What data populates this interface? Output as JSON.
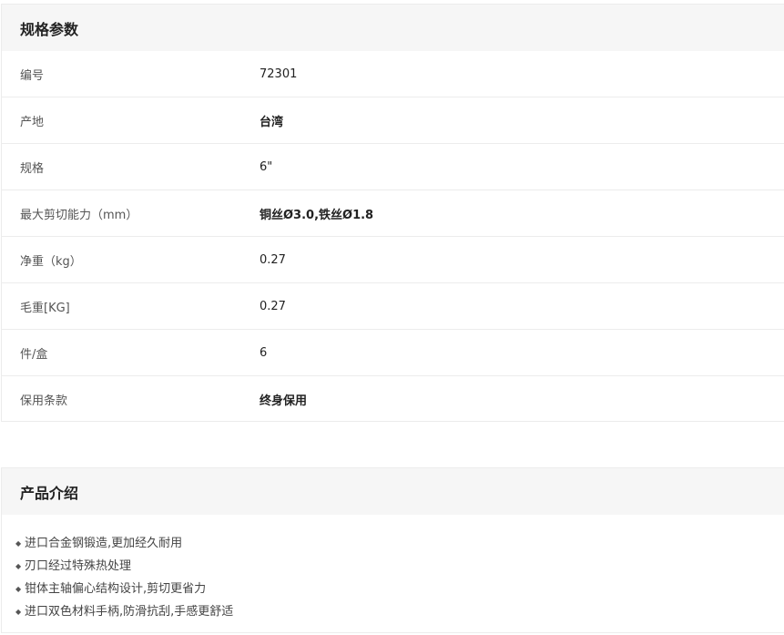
{
  "specs": {
    "title": "规格参数",
    "rows": [
      {
        "label": "编号",
        "value": "72301"
      },
      {
        "label": "产地",
        "value": "台湾"
      },
      {
        "label": "规格",
        "value": "6\""
      },
      {
        "label": "最大剪切能力（mm）",
        "value": "铜丝Ø3.0,铁丝Ø1.8"
      },
      {
        "label": "净重（kg）",
        "value": "0.27"
      },
      {
        "label": "毛重[KG]",
        "value": "0.27"
      },
      {
        "label": "件/盒",
        "value": "6"
      },
      {
        "label": "保用条款",
        "value": "终身保用"
      }
    ]
  },
  "intro": {
    "title": "产品介绍",
    "bullet_icon": "diamond-bullet-icon",
    "bullet_glyph": "◆",
    "items": [
      "进口合金钢锻造,更加经久耐用",
      "刃口经过特殊热处理",
      "钳体主轴偏心结构设计,剪切更省力",
      "进口双色材料手柄,防滑抗刮,手感更舒适"
    ]
  }
}
